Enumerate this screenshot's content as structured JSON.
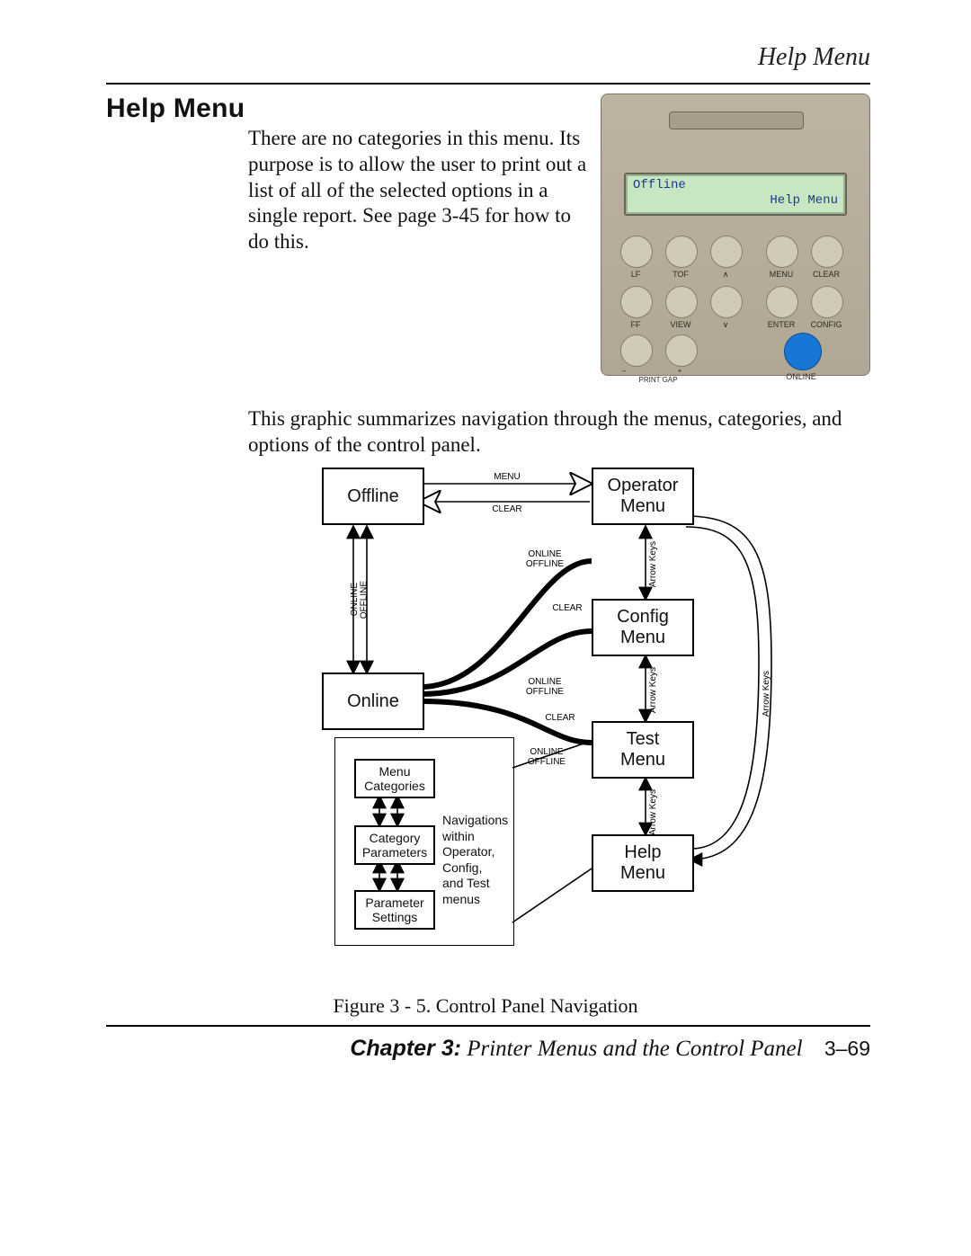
{
  "running_head": "Help Menu",
  "heading": "Help Menu",
  "intro_text": "There are no categories in this menu. Its purpose is to allow the user to print out a list of all of the selected options in a single report. See page 3-45 for how to do this.",
  "body2_text": "This graphic summarizes navigation through the menus, categories, and options of the control panel.",
  "figure_caption": "Figure 3 - 5.  Control Panel Navigation",
  "footer": {
    "chapter": "Chapter 3:",
    "title": " Printer Menus and the Control Panel",
    "page": "3–69"
  },
  "panel": {
    "lcd_line1": "Offline",
    "lcd_line2": "Help Menu",
    "row1": {
      "b1": "LF",
      "b2": "TOF",
      "b3": "∧",
      "b4": "MENU",
      "b5": "CLEAR"
    },
    "row2": {
      "b1": "FF",
      "b2": "VIEW",
      "b3": "∨",
      "b4": "ENTER",
      "b5": "CONFIG"
    },
    "row3": {
      "minus": "–",
      "plus": "+",
      "gap": "PRINT GAP",
      "online": "ONLINE"
    }
  },
  "diagram": {
    "nodes": {
      "offline": "Offline",
      "online": "Online",
      "operator": "Operator\nMenu",
      "config": "Config\nMenu",
      "test": "Test\nMenu",
      "help": "Help\nMenu",
      "menu_categories": "Menu\nCategories",
      "category_parameters": "Category\nParameters",
      "parameter_settings": "Parameter\nSettings"
    },
    "labels": {
      "menu": "MENU",
      "clear": "CLEAR",
      "online_offline": "ONLINE\nOFFLINE",
      "arrow_keys": "Arrow Keys"
    },
    "note": "Navigations\nwithin\nOperator,\nConfig,\nand Test\nmenus"
  }
}
